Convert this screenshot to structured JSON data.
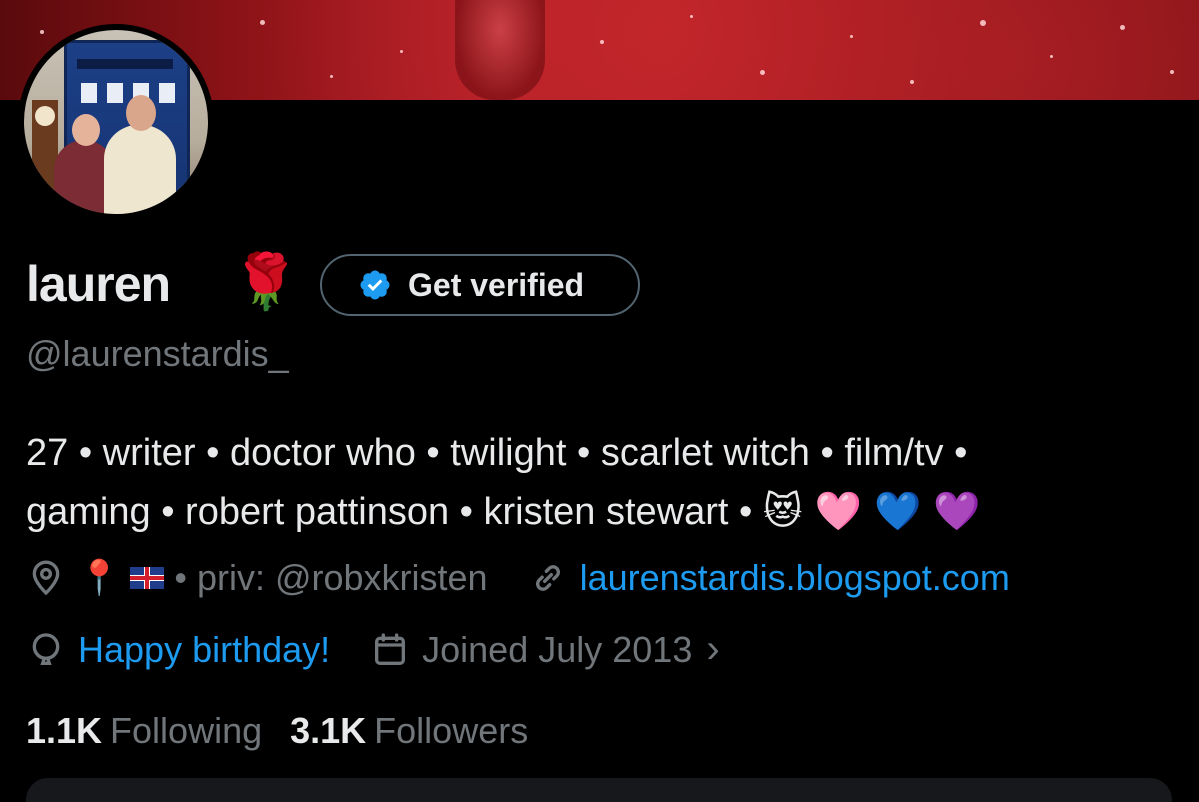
{
  "profile": {
    "display_name": "lauren",
    "name_emoji": "🌹",
    "handle": "@laurenstardis_",
    "verify_button_label": "Get verified"
  },
  "bio": {
    "line1": "27 • writer • doctor who • twilight • scarlet witch • film/tv •",
    "line2": "gaming • robert pattinson • kristen stewart • ",
    "emojis": "😻 🩷 💙 💜"
  },
  "meta": {
    "location_pin": "📍",
    "location_text": "• priv: @robxkristen",
    "website": "laurenstardis.blogspot.com",
    "birthday": "Happy birthday!",
    "joined": "Joined July 2013",
    "joined_chevron": "›"
  },
  "stats": {
    "following_count": "1.1K",
    "following_label": "Following",
    "followers_count": "3.1K",
    "followers_label": "Followers"
  },
  "colors": {
    "link": "#1d9bf0",
    "muted": "#71767b",
    "text": "#e7e9ea",
    "background": "#000000",
    "verified_badge": "#1d9bf0"
  },
  "icons": {
    "verified": "verified-badge-icon",
    "location": "location-icon",
    "link": "link-icon",
    "birthday": "balloon-icon",
    "joined": "calendar-icon"
  }
}
